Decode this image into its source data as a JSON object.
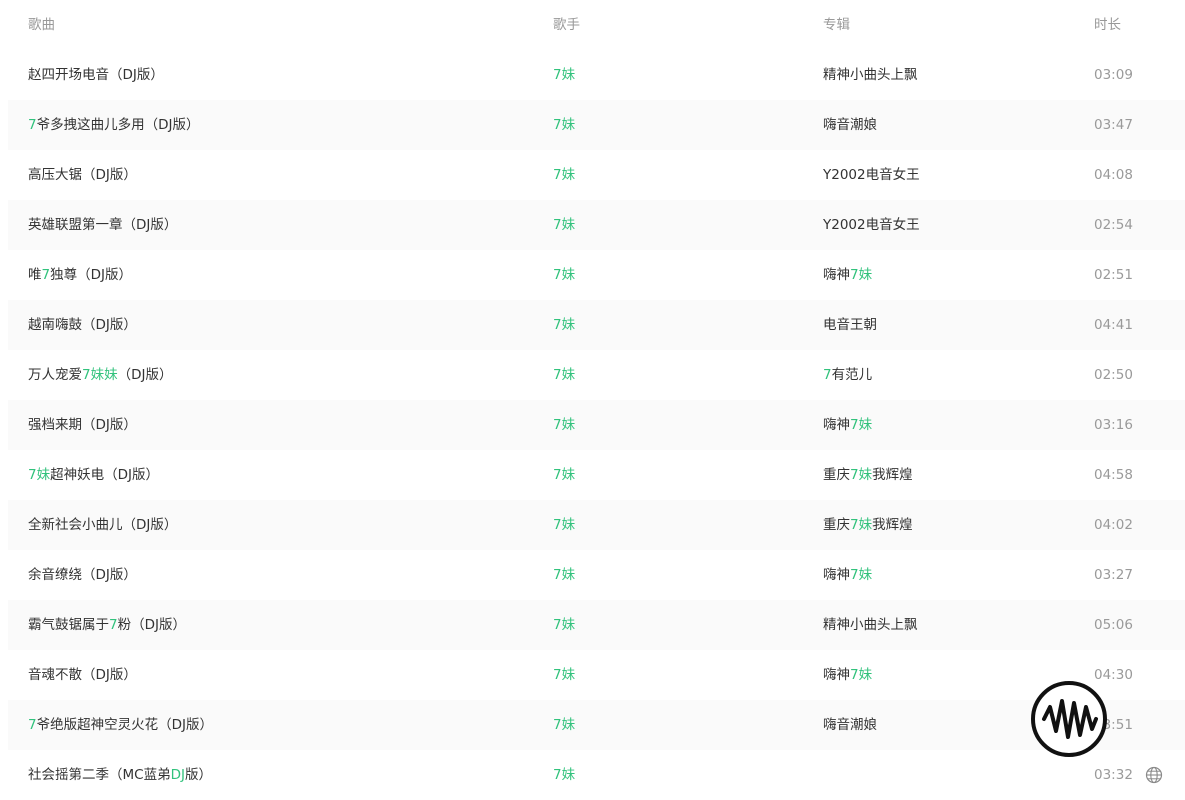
{
  "header": {
    "title": "歌曲",
    "artist": "歌手",
    "album": "专辑",
    "duration": "时长"
  },
  "songs": [
    {
      "title": [
        {
          "t": "赵四开场电音（DJ版）"
        }
      ],
      "artist": "7妹",
      "album": [
        {
          "t": "精神小曲头上飘"
        }
      ],
      "duration": "03:09"
    },
    {
      "title": [
        {
          "t": "7",
          "h": true
        },
        {
          "t": "爷多拽这曲儿多用（DJ版）"
        }
      ],
      "artist": "7妹",
      "album": [
        {
          "t": "嗨音潮娘"
        }
      ],
      "duration": "03:47"
    },
    {
      "title": [
        {
          "t": "高压大锯（DJ版）"
        }
      ],
      "artist": "7妹",
      "album": [
        {
          "t": "Y2002电音女王"
        }
      ],
      "duration": "04:08"
    },
    {
      "title": [
        {
          "t": "英雄联盟第一章（DJ版）"
        }
      ],
      "artist": "7妹",
      "album": [
        {
          "t": "Y2002电音女王"
        }
      ],
      "duration": "02:54"
    },
    {
      "title": [
        {
          "t": "唯"
        },
        {
          "t": "7",
          "h": true
        },
        {
          "t": "独尊（DJ版）"
        }
      ],
      "artist": "7妹",
      "album": [
        {
          "t": "嗨神"
        },
        {
          "t": "7妹",
          "h": true
        }
      ],
      "duration": "02:51"
    },
    {
      "title": [
        {
          "t": "越南嗨鼓（DJ版）"
        }
      ],
      "artist": "7妹",
      "album": [
        {
          "t": "电音王朝"
        }
      ],
      "duration": "04:41"
    },
    {
      "title": [
        {
          "t": "万人宠爱"
        },
        {
          "t": "7妹妹",
          "h": true
        },
        {
          "t": "（DJ版）"
        }
      ],
      "artist": "7妹",
      "album": [
        {
          "t": "7",
          "h": true
        },
        {
          "t": "有范儿"
        }
      ],
      "duration": "02:50"
    },
    {
      "title": [
        {
          "t": "强档来期（DJ版）"
        }
      ],
      "artist": "7妹",
      "album": [
        {
          "t": "嗨神"
        },
        {
          "t": "7妹",
          "h": true
        }
      ],
      "duration": "03:16"
    },
    {
      "title": [
        {
          "t": "7妹",
          "h": true
        },
        {
          "t": "超神妖电（DJ版）"
        }
      ],
      "artist": "7妹",
      "album": [
        {
          "t": "重庆"
        },
        {
          "t": "7妹",
          "h": true
        },
        {
          "t": "我辉煌"
        }
      ],
      "duration": "04:58"
    },
    {
      "title": [
        {
          "t": "全新社会小曲儿（DJ版）"
        }
      ],
      "artist": "7妹",
      "album": [
        {
          "t": "重庆"
        },
        {
          "t": "7妹",
          "h": true
        },
        {
          "t": "我辉煌"
        }
      ],
      "duration": "04:02"
    },
    {
      "title": [
        {
          "t": "余音缭绕（DJ版）"
        }
      ],
      "artist": "7妹",
      "album": [
        {
          "t": "嗨神"
        },
        {
          "t": "7妹",
          "h": true
        }
      ],
      "duration": "03:27"
    },
    {
      "title": [
        {
          "t": "霸气鼓锯属于"
        },
        {
          "t": "7",
          "h": true
        },
        {
          "t": "粉（DJ版）"
        }
      ],
      "artist": "7妹",
      "album": [
        {
          "t": "精神小曲头上飘"
        }
      ],
      "duration": "05:06"
    },
    {
      "title": [
        {
          "t": "音魂不散（DJ版）"
        }
      ],
      "artist": "7妹",
      "album": [
        {
          "t": "嗨神"
        },
        {
          "t": "7妹",
          "h": true
        }
      ],
      "duration": "04:30"
    },
    {
      "title": [
        {
          "t": "7",
          "h": true
        },
        {
          "t": "爷绝版超神空灵火花（DJ版）"
        }
      ],
      "artist": "7妹",
      "album": [
        {
          "t": "嗨音潮娘"
        }
      ],
      "duration": "03:51"
    },
    {
      "title": [
        {
          "t": "社会摇第二季（MC蓝弟"
        },
        {
          "t": "DJ",
          "h": true
        },
        {
          "t": "版）"
        }
      ],
      "artist": "7妹",
      "album": [],
      "duration": "03:32"
    }
  ],
  "colors": {
    "accent": "#31c27c",
    "header_text": "#999999",
    "row_alt_bg": "#fafafa"
  },
  "icons": {
    "language": "globe-icon",
    "badge": "waveform-badge-icon"
  }
}
